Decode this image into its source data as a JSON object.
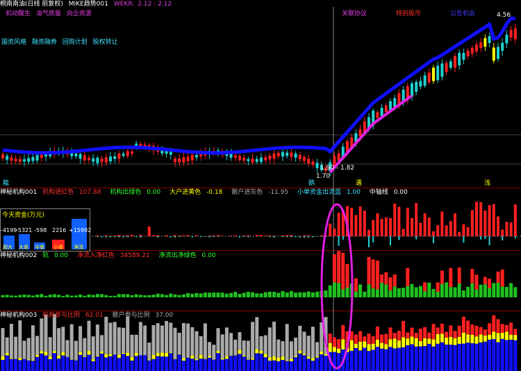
{
  "header": {
    "title": "桐南南油(日线 前复权)",
    "indicator": "MIKE趋势001",
    "vwap_label": "WEKR:",
    "vwap_values": "2.12 : 2.12"
  },
  "main_badges": [
    "机动醒生",
    "油气质量",
    "向企资源"
  ],
  "main_tags": [
    "国资风格",
    "融资融券",
    "回购计划",
    "股权转让"
  ],
  "top_labels": [
    "关联协议",
    "特别股市",
    "公告机会"
  ],
  "price_labels": {
    "high": "4.56",
    "mid": "1.90 - 1.82",
    "low": "1.70"
  },
  "bottom_axis": [
    "龍",
    "鹅",
    "遇",
    "浅"
  ],
  "panel1": {
    "name": "神秘机构001",
    "items": [
      {
        "label": "机构进红色",
        "value": "107.88",
        "color": "#ff3030"
      },
      {
        "label": "机构出绿色",
        "value": "0.00",
        "color": "#30ff30"
      },
      {
        "label": "大户进黄色",
        "value": "-0.18",
        "color": "#ffff00"
      },
      {
        "label": "散户进灰色",
        "value": "-11.95",
        "color": "#aaaaaa"
      },
      {
        "label": "小单资金出流蓝",
        "value": "1.00",
        "color": "#40e0ff"
      },
      {
        "label": "中轴线",
        "value": "0.00",
        "color": "#ffffff"
      }
    ]
  },
  "capital_box": {
    "title": "今天资金(万元)",
    "values": [
      "-4199",
      "-5321",
      "-598",
      "2216",
      "+15992"
    ],
    "labels": [
      "超大",
      "大单",
      "中单",
      "小单",
      "净流"
    ]
  },
  "panel2": {
    "name": "神秘机构002",
    "items": [
      {
        "label": "轨",
        "value": "0.00",
        "color": "#30ff30"
      },
      {
        "label": "净流入净红色",
        "value": "34589.21",
        "color": "#ff3030"
      },
      {
        "label": "净流出净绿色",
        "value": "0.00",
        "color": "#30ff30"
      }
    ]
  },
  "panel3": {
    "name": "神秘机构003",
    "items": [
      {
        "label": "机构参与比例",
        "value": "62.01",
        "color": "#ff3030"
      },
      {
        "label": "散户参与比例",
        "value": "37.00",
        "color": "#aaaaaa"
      }
    ]
  },
  "colors": {
    "up": "#ff2020",
    "down": "#20d0d0",
    "boll": "#1010ff",
    "magenta": "#e020e0",
    "yellow": "#ffff00",
    "grey": "#aaaaaa",
    "green": "#20c020",
    "divider": "#8b0000"
  }
}
